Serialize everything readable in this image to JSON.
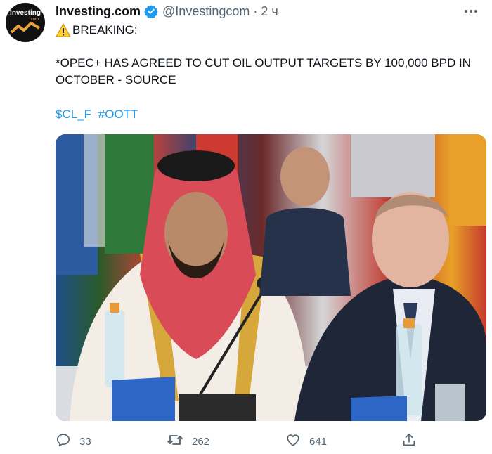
{
  "tweet": {
    "author_name": "Investing.com",
    "handle": "@Investingcom",
    "separator": "·",
    "time": "2 ч",
    "avatar_label": "Investing",
    "avatar_sub": ".com",
    "line1": "BREAKING:",
    "line2": "*OPEC+ HAS AGREED TO CUT OIL OUTPUT TARGETS BY 100,000 BPD IN OCTOBER - SOURCE",
    "cashtag": "$CL_F",
    "hashtag": "#OOTT",
    "verified_color": "#1d9bf0",
    "link_color": "#1d9bf0",
    "photo_icon": "photo-image"
  },
  "actions": {
    "reply_count": "33",
    "retweet_count": "262",
    "like_count": "641"
  }
}
